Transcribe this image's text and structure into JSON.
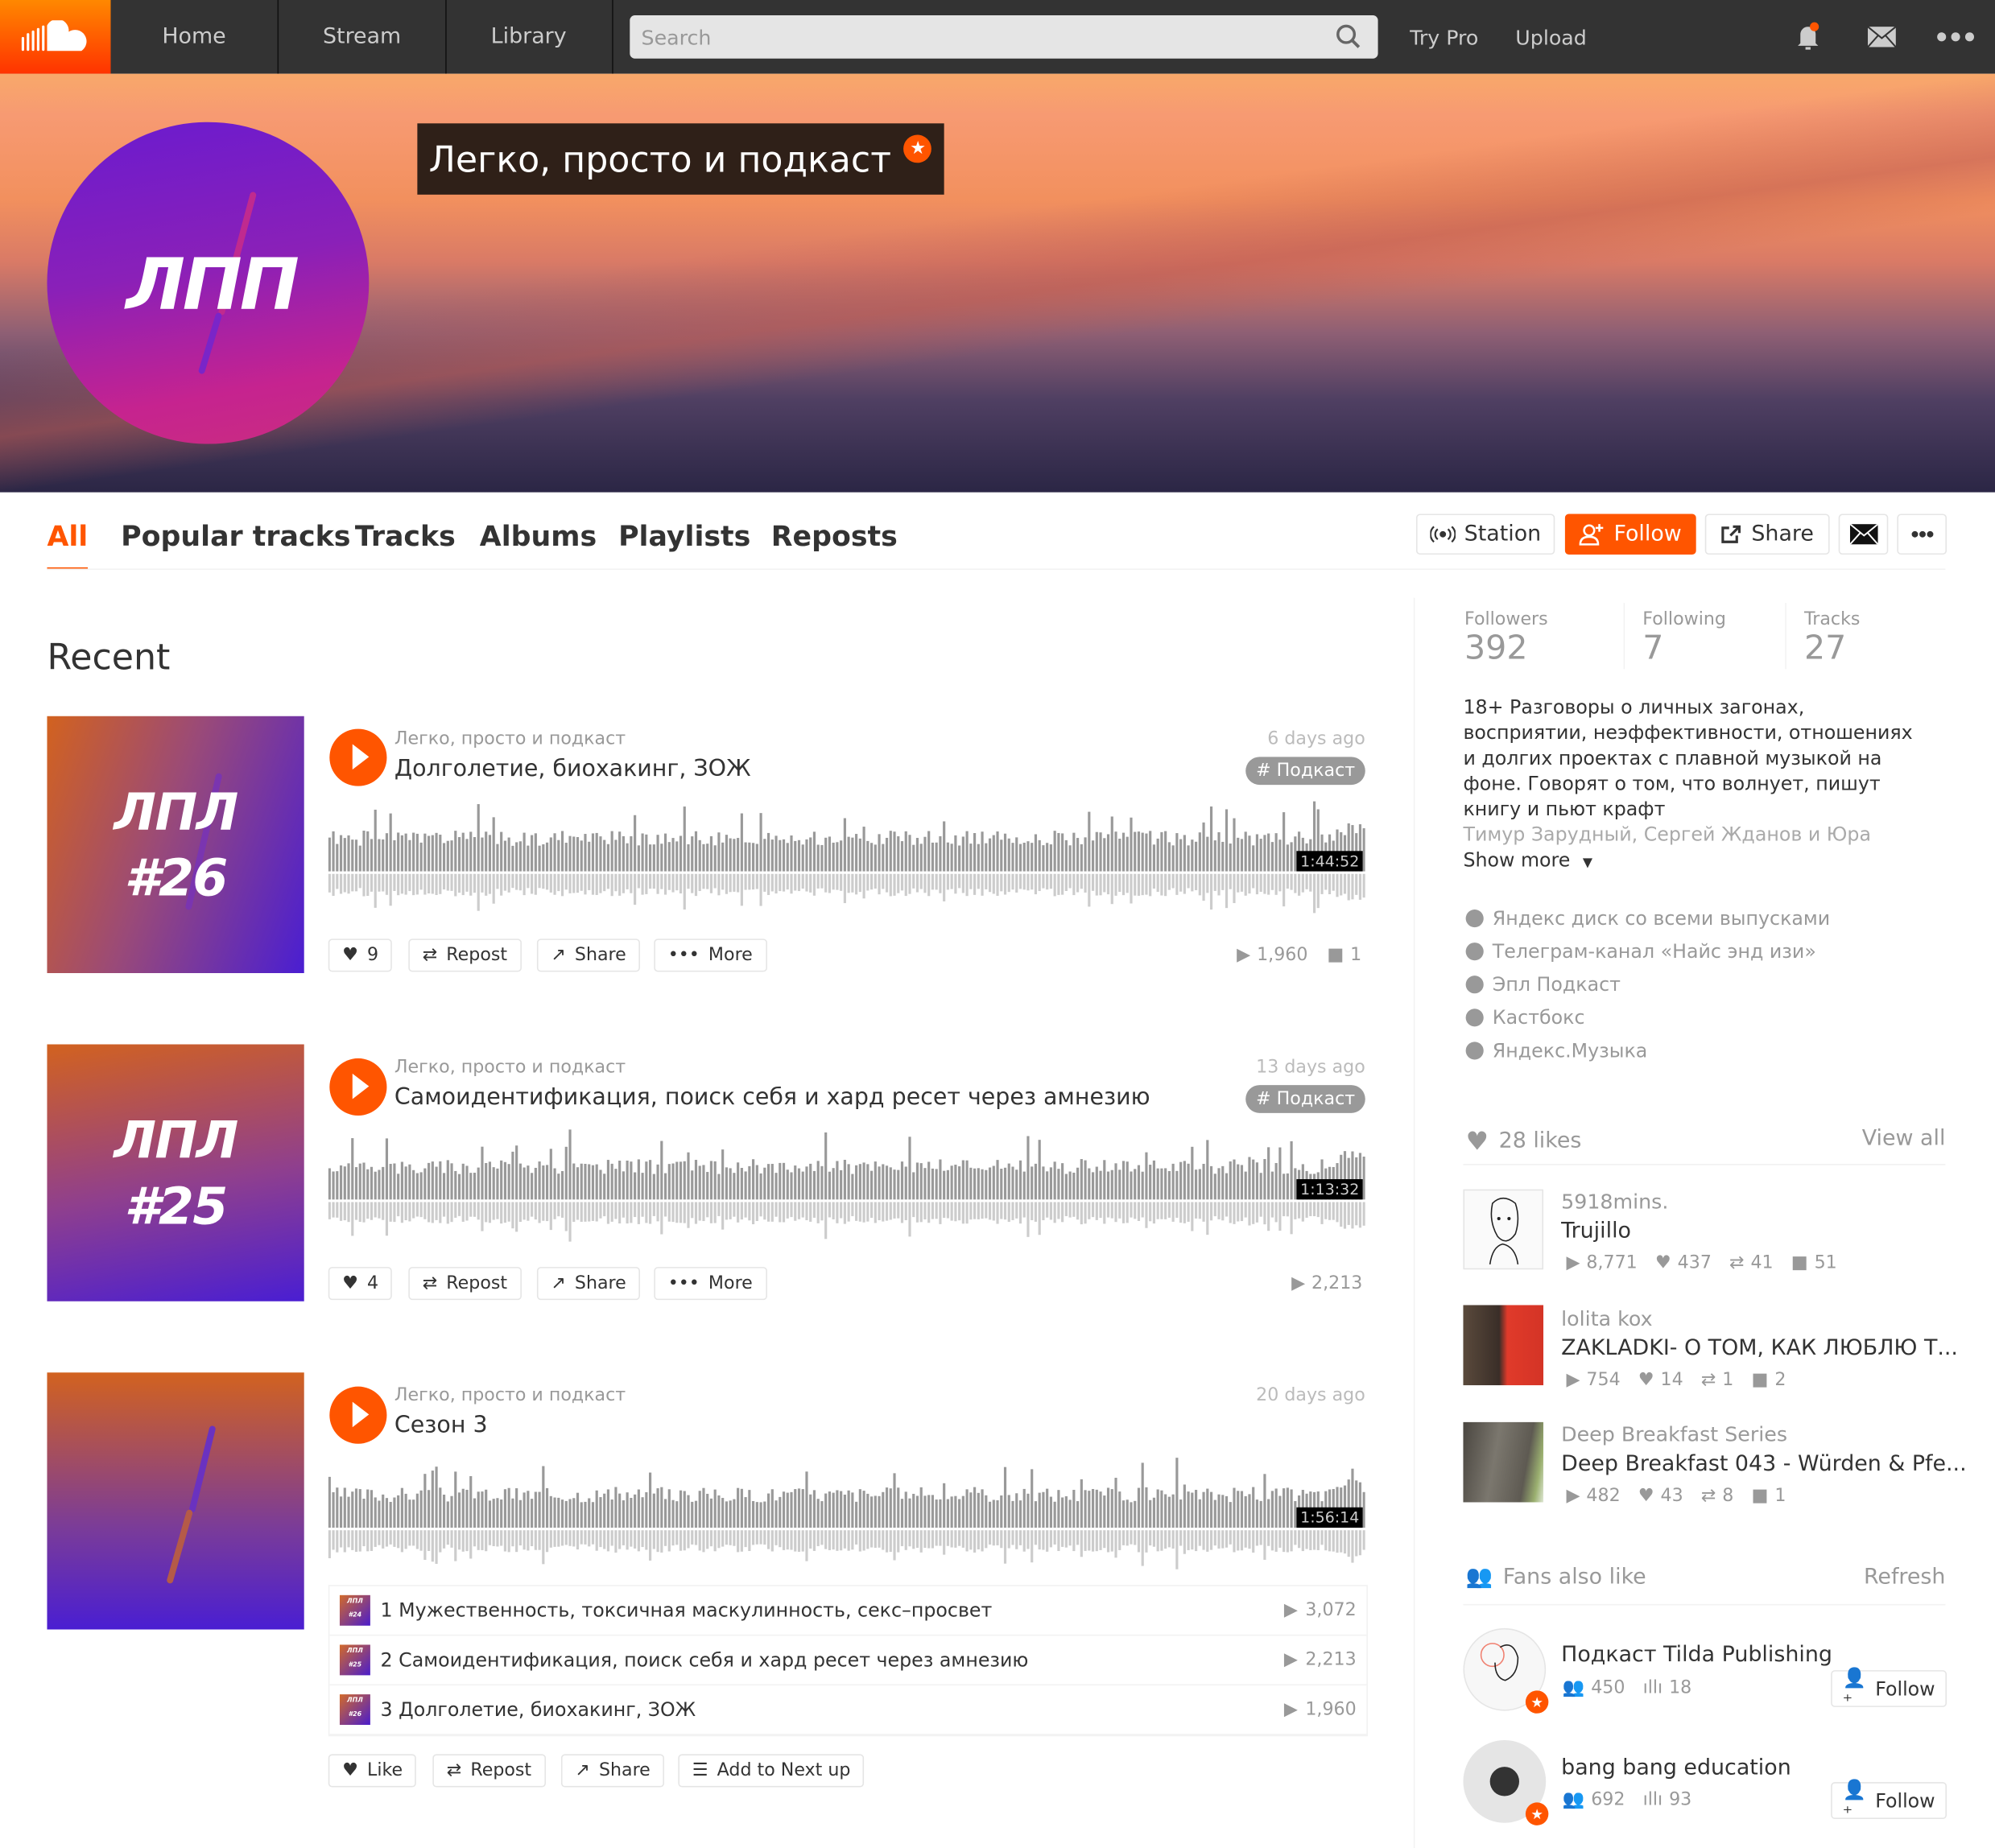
{
  "header": {
    "nav": [
      "Home",
      "Stream",
      "Library"
    ],
    "search_placeholder": "Search",
    "try_pro": "Try Pro",
    "upload": "Upload",
    "icons": [
      "soundcloud-logo",
      "search-icon",
      "bell-icon",
      "mail-icon",
      "more-icon"
    ],
    "accent": "#ff5500"
  },
  "profile": {
    "name": "Легко, просто и подкаст",
    "avatar_text": "ЛПП",
    "pro_badge": "★"
  },
  "tabs": [
    "All",
    "Popular tracks",
    "Tracks",
    "Albums",
    "Playlists",
    "Reposts"
  ],
  "active_tab": "All",
  "actions": {
    "station": "Station",
    "follow": "Follow",
    "share": "Share"
  },
  "section_title": "Recent",
  "tracks": [
    {
      "user": "Легко, просто и подкаст",
      "title": "Долголетие, биохакинг, ЗОЖ",
      "date": "6 days ago",
      "tag": "# Подкаст",
      "duration": "1:44:52",
      "art_text": [
        "ЛПЛ",
        "#26"
      ],
      "likes": "9",
      "repost": "Repost",
      "share": "Share",
      "more": "More",
      "plays": "1,960",
      "comments": "1"
    },
    {
      "user": "Легко, просто и подкаст",
      "title": "Самоидентификация, поиск себя и хард ресет через амнезию",
      "date": "13 days ago",
      "tag": "# Подкаст",
      "duration": "1:13:32",
      "art_text": [
        "ЛПЛ",
        "#25"
      ],
      "likes": "4",
      "repost": "Repost",
      "share": "Share",
      "more": "More",
      "plays": "2,213"
    },
    {
      "user": "Легко, просто и подкаст",
      "title": "Сезон 3",
      "date": "20 days ago",
      "duration": "1:56:14",
      "playlist": [
        {
          "num": "1",
          "title": "Мужественность, токсичная маскулинность, секс–просвет",
          "plays": "3,072",
          "thumb": "ЛПЛ #24"
        },
        {
          "num": "2",
          "title": "Самоидентификация, поиск себя и хард ресет через амнезию",
          "plays": "2,213",
          "thumb": "ЛПЛ #25"
        },
        {
          "num": "3",
          "title": "Долголетие, биохакинг, ЗОЖ",
          "plays": "1,960",
          "thumb": "ЛПЛ #26"
        }
      ],
      "like": "Like",
      "repost": "Repost",
      "share": "Share",
      "next_up": "Add to Next up"
    }
  ],
  "sidebar": {
    "stats": [
      {
        "label": "Followers",
        "value": "392"
      },
      {
        "label": "Following",
        "value": "7"
      },
      {
        "label": "Tracks",
        "value": "27"
      }
    ],
    "bio": "18+ Разговоры о личных загонах, восприятии, неэффективности, отношениях и долгих проектах с плавной музыкой на фоне. Говорят о том, что волнует, пишут книгу и пьют крафт",
    "bio_faded": "Тимур Зарудный, Сергей Жданов и Юра",
    "show_more": "Show more",
    "links": [
      "Яндекс диск со всеми выпусками",
      "Телеграм-канал «Найс энд изи»",
      "Эпл Подкаст",
      "Кастбокс",
      "Яндекс.Музыка"
    ],
    "likes_header": "28 likes",
    "view_all": "View all",
    "liked": [
      {
        "user": "5918mins.",
        "title": "Trujillo",
        "plays": "8,771",
        "likes": "437",
        "reposts": "41",
        "comments": "51"
      },
      {
        "user": "lolita kox",
        "title": "ZAKLADKI- О ТОМ, КАК ЛЮБЛЮ Т...",
        "plays": "754",
        "likes": "14",
        "reposts": "1",
        "comments": "2"
      },
      {
        "user": "Deep Breakfast Series",
        "title": "Deep Breakfast 043 - Würden & Pfe...",
        "plays": "482",
        "likes": "43",
        "reposts": "8",
        "comments": "1"
      }
    ],
    "fans_header": "Fans also like",
    "refresh": "Refresh",
    "fans": [
      {
        "name": "Подкаст Tilda Publishing",
        "followers": "450",
        "tracks": "18",
        "follow": "Follow"
      },
      {
        "name": "bang bang education",
        "followers": "692",
        "tracks": "93",
        "follow": "Follow"
      }
    ]
  }
}
